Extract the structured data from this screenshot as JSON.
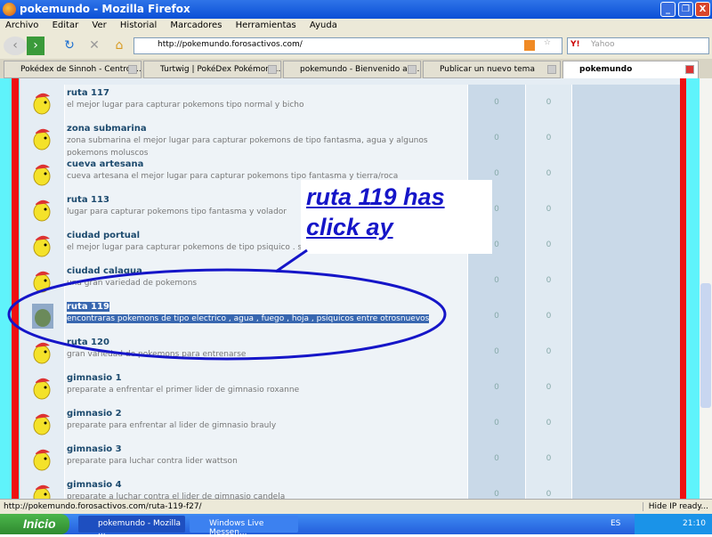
{
  "window": {
    "title": "pokemundo - Mozilla Firefox",
    "controls": [
      "_",
      "❐",
      "X"
    ]
  },
  "menu": [
    "Archivo",
    "Editar",
    "Ver",
    "Historial",
    "Marcadores",
    "Herramientas",
    "Ayuda"
  ],
  "nav": {
    "url": "http://pokemundo.forosactivos.com/",
    "search_placeholder": "Yahoo"
  },
  "tabs": [
    {
      "label": "Pokédex de Sinnoh - Centro ..."
    },
    {
      "label": "Turtwig | PokéDex Pokémon ..."
    },
    {
      "label": "pokemundo - Bienvenido a la..."
    },
    {
      "label": "Publicar un nuevo tema"
    },
    {
      "label": "pokemundo",
      "active": true
    }
  ],
  "forums": [
    {
      "name": "ruta 117",
      "desc": "el mejor lugar para capturar pokemons tipo normal y bicho",
      "topics": "0",
      "posts": "0"
    },
    {
      "name": "zona submarina",
      "desc": "zona submarina el mejor lugar para capturar pokemons de tipo fantasma, agua y algunos pokemons moluscos",
      "topics": "0",
      "posts": "0"
    },
    {
      "name": "cueva artesana",
      "desc": "cueva artesana el mejor lugar para capturar pokemons tipo fantasma y tierra/roca",
      "topics": "0",
      "posts": "0"
    },
    {
      "name": "ruta 113",
      "desc": "lugar para capturar pokemons tipo fantasma y volador",
      "topics": "0",
      "posts": "0"
    },
    {
      "name": "ciudad portual",
      "desc": "el mejor lugar para capturar pokemons de tipo psiquico . so",
      "topics": "0",
      "posts": "0"
    },
    {
      "name": "ciudad calagua",
      "desc": "una gran variedad de pokemons",
      "topics": "0",
      "posts": "0"
    },
    {
      "name": "ruta 119",
      "desc": "encontraras pokemons de tipo electrico , agua , fuego , hoja , psiquicos entre otrosnuevos",
      "topics": "0",
      "posts": "0",
      "selected": true
    },
    {
      "name": "ruta 120",
      "desc": "gran variedad de pokemons para entrenarse",
      "topics": "0",
      "posts": "0"
    },
    {
      "name": "gimnasio 1",
      "desc": "preparate a enfrentar el primer lider de gimnasio roxanne",
      "topics": "0",
      "posts": "0"
    },
    {
      "name": "gimnasio 2",
      "desc": "preparate para enfrentar al lider de gimnasio brauly",
      "topics": "0",
      "posts": "0"
    },
    {
      "name": "gimnasio 3",
      "desc": "preparate para luchar contra lider wattson",
      "topics": "0",
      "posts": "0"
    },
    {
      "name": "gimnasio 4",
      "desc": "preparate a luchar contra el lider de gimnasio candela",
      "topics": "0",
      "posts": "0"
    }
  ],
  "annotation": {
    "line1": "ruta 119 has",
    "line2": "click ay",
    "color": "#1515c8"
  },
  "status": {
    "url": "http://pokemundo.forosactivos.com/ruta-119-f27/",
    "right": "Hide IP ready..."
  },
  "taskbar": {
    "start": "Inicio",
    "tasks": [
      "pokemundo - Mozilla ...",
      "Windows Live Messen..."
    ],
    "lang": "ES",
    "clock": "21:10"
  }
}
